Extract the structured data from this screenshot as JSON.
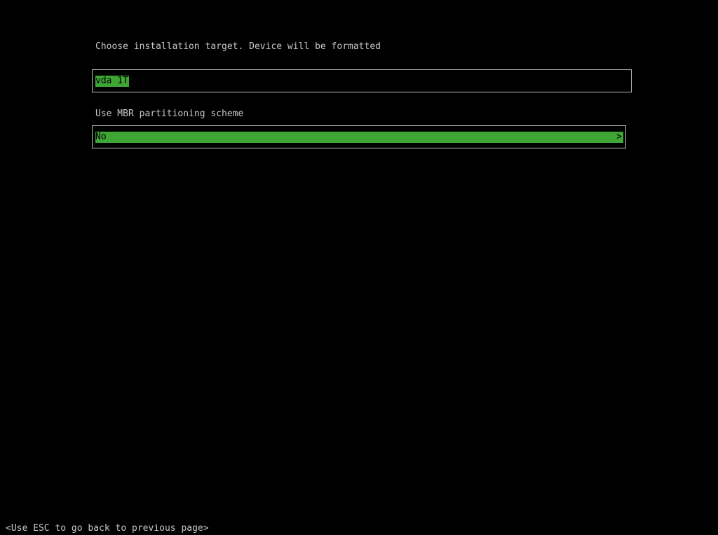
{
  "installer": {
    "target": {
      "label": "Choose installation target. Device will be formatted",
      "selected": "vda 1T"
    },
    "mbr": {
      "label": "Use MBR partitioning scheme",
      "selected": "No",
      "chevron": ">"
    }
  },
  "footer": {
    "hint": "<Use ESC to go back to previous page>"
  },
  "colors": {
    "background": "#000000",
    "text": "#c8c8c8",
    "highlight": "#3fa535",
    "border": "#bdbdbd"
  }
}
